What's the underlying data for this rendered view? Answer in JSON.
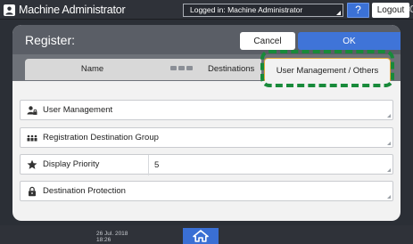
{
  "topbar": {
    "title": "Machine Administrator",
    "login_status": "Logged in: Machine Administrator",
    "help_label": "?",
    "logout_label": "Logout",
    "moon_glyph": "☾"
  },
  "dialog": {
    "title": "Register:",
    "cancel_label": "Cancel",
    "ok_label": "OK"
  },
  "tabs": [
    {
      "label": "Name",
      "selected": false
    },
    {
      "label": "Destinations",
      "selected": false
    },
    {
      "label": "User Management / Others",
      "selected": true
    }
  ],
  "rows": [
    {
      "label": "User Management",
      "icon": "user-lock-icon",
      "value": ""
    },
    {
      "label": "Registration Destination Group",
      "icon": "group-icon",
      "value": ""
    },
    {
      "label": "Display Priority",
      "icon": "star-icon",
      "value": "5"
    },
    {
      "label": "Destination Protection",
      "icon": "lock-icon",
      "value": ""
    }
  ],
  "bottombar": {
    "date": "26 Jul. 2018",
    "time": "18:26"
  },
  "colors": {
    "highlight": "#188a3a",
    "accent_blue": "#3f74d8",
    "selected_tab_border": "#e0a93b"
  }
}
